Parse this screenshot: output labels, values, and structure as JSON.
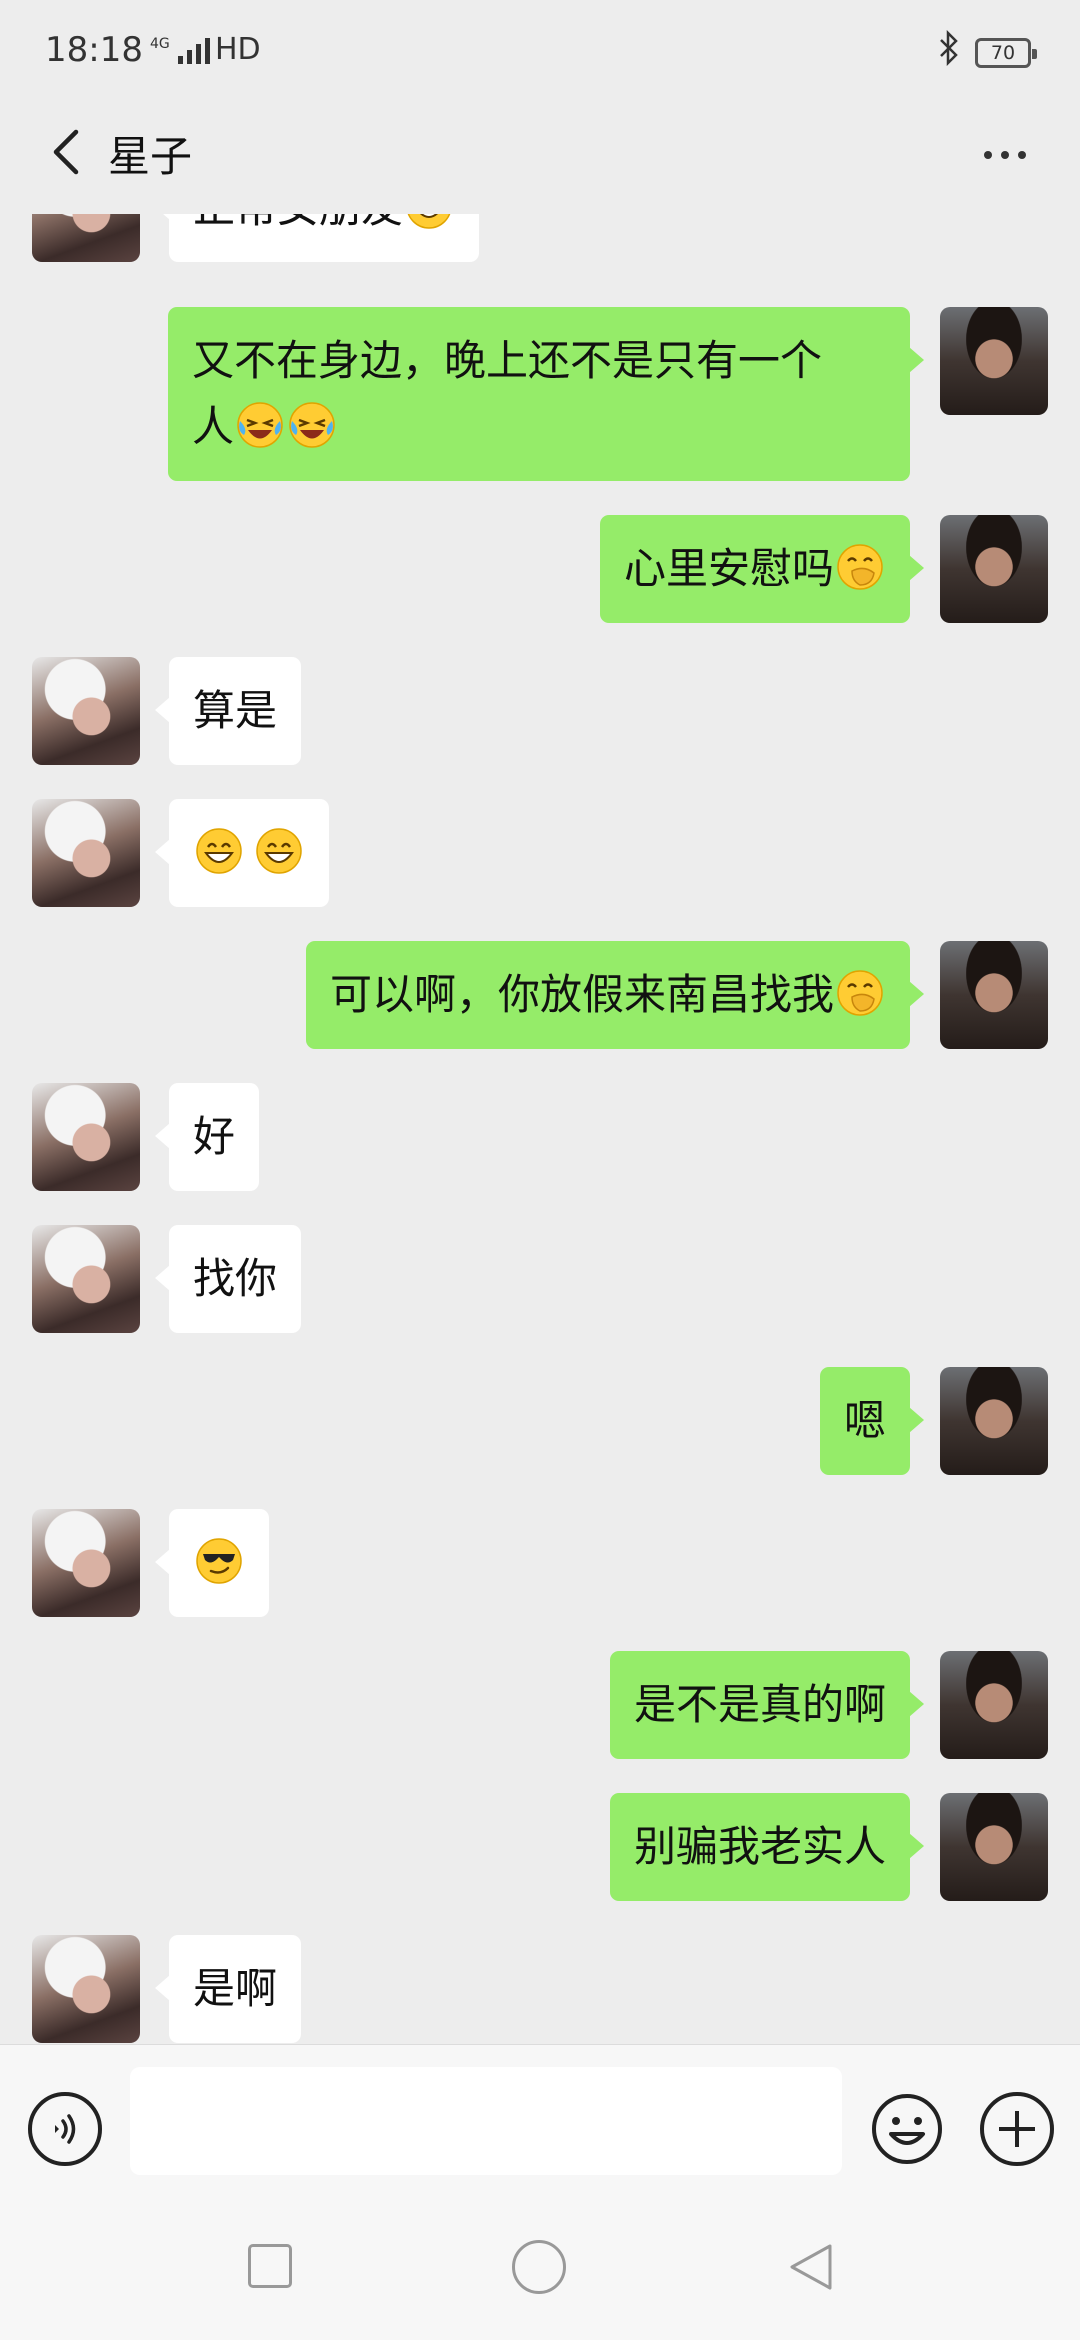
{
  "status_bar": {
    "time": "18:18",
    "network": "4G",
    "hd_label": "HD",
    "battery": "70"
  },
  "header": {
    "title": "星子"
  },
  "messages": [
    {
      "side": "left",
      "text": "正常女朋友",
      "emojis": [
        "grin"
      ]
    },
    {
      "side": "right",
      "text_line1": "又不在身边，晚上还不是只有一个",
      "text_line2": "人",
      "emojis": [
        "laugh-cry",
        "laugh-cry"
      ]
    },
    {
      "side": "right",
      "text": "心里安慰吗",
      "emojis": [
        "hand-over-mouth"
      ]
    },
    {
      "side": "left",
      "text": "算是"
    },
    {
      "side": "left",
      "text": "",
      "emojis": [
        "grin",
        "grin"
      ]
    },
    {
      "side": "right",
      "text": "可以啊，你放假来南昌找我",
      "emojis": [
        "hand-over-mouth"
      ]
    },
    {
      "side": "left",
      "text": "好"
    },
    {
      "side": "left",
      "text": "找你"
    },
    {
      "side": "right",
      "text": "嗯"
    },
    {
      "side": "left",
      "text": "",
      "emojis": [
        "cool"
      ]
    },
    {
      "side": "right",
      "text": "是不是真的啊"
    },
    {
      "side": "right",
      "text": "别骗我老实人"
    },
    {
      "side": "left",
      "text": "是啊"
    }
  ],
  "input_bar": {
    "placeholder": "",
    "icons": [
      "voice-icon",
      "emoji-icon",
      "plus-icon"
    ]
  },
  "colors": {
    "background": "#ededed",
    "sent_bubble": "#95ec69",
    "received_bubble": "#ffffff"
  }
}
